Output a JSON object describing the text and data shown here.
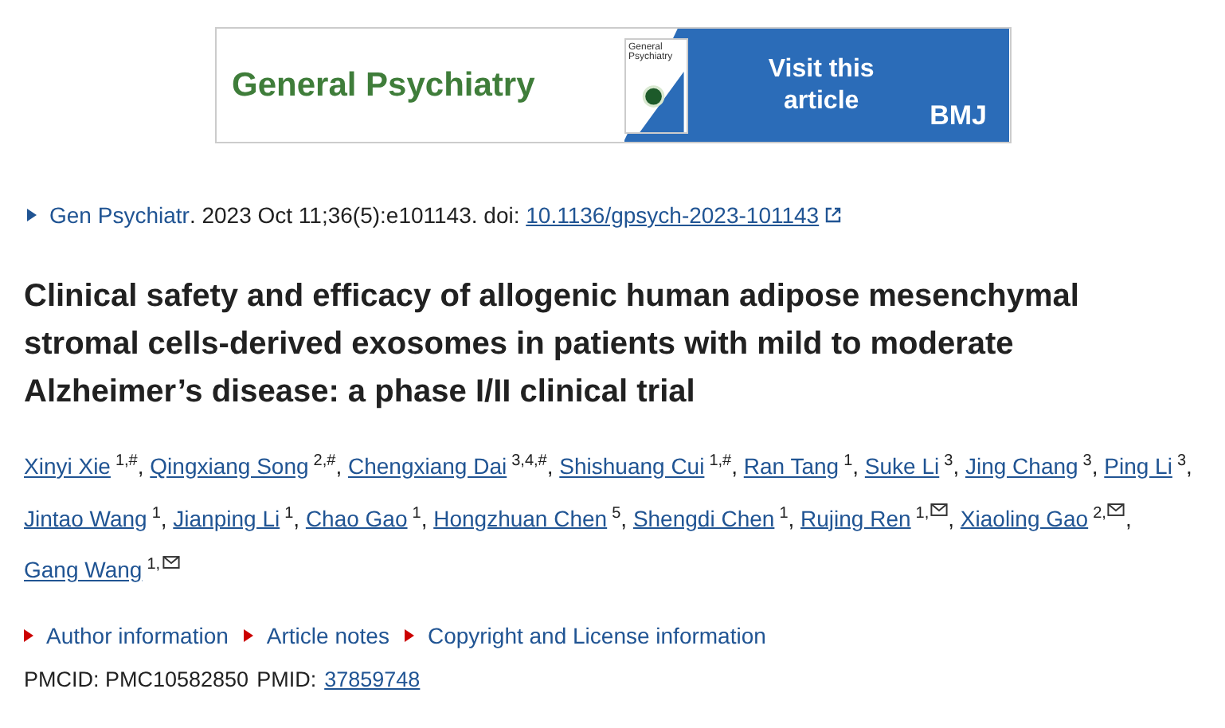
{
  "banner": {
    "journal": "General Psychiatry",
    "cover_title": "General Psychiatry",
    "cta": "Visit this article",
    "publisher": "BMJ"
  },
  "citation": {
    "journal": "Gen Psychiatr",
    "details": ". 2023 Oct 11;36(5):e101143. doi: ",
    "doi": "10.1136/gpsych-2023-101143"
  },
  "title": "Clinical safety and efficacy of allogenic human adipose mesenchymal stromal cells-derived exosomes in patients with mild to moderate Alzheimer’s disease: a phase I/II clinical trial",
  "authors": [
    {
      "name": "Xinyi Xie",
      "affiliations": "1,#",
      "corresponding": false,
      "separator": ","
    },
    {
      "name": "Qingxiang Song",
      "affiliations": "2,#",
      "corresponding": false,
      "separator": ","
    },
    {
      "name": "Chengxiang Dai",
      "affiliations": "3,4,#",
      "corresponding": false,
      "separator": ","
    },
    {
      "name": "Shishuang Cui",
      "affiliations": "1,#",
      "corresponding": false,
      "separator": ","
    },
    {
      "name": "Ran Tang",
      "affiliations": "1",
      "corresponding": false,
      "separator": ","
    },
    {
      "name": "Suke Li",
      "affiliations": "3",
      "corresponding": false,
      "separator": ","
    },
    {
      "name": "Jing Chang",
      "affiliations": "3",
      "corresponding": false,
      "separator": ","
    },
    {
      "name": "Ping Li",
      "affiliations": "3",
      "corresponding": false,
      "separator": ","
    },
    {
      "name": "Jintao Wang",
      "affiliations": "1",
      "corresponding": false,
      "separator": ","
    },
    {
      "name": "Jianping Li",
      "affiliations": "1",
      "corresponding": false,
      "separator": ","
    },
    {
      "name": "Chao Gao",
      "affiliations": "1",
      "corresponding": false,
      "separator": ","
    },
    {
      "name": "Hongzhuan Chen",
      "affiliations": "5",
      "corresponding": false,
      "separator": ","
    },
    {
      "name": "Shengdi Chen",
      "affiliations": "1",
      "corresponding": false,
      "separator": ","
    },
    {
      "name": "Rujing Ren",
      "affiliations": "1,",
      "corresponding": true,
      "separator": ","
    },
    {
      "name": "Xiaoling Gao",
      "affiliations": "2,",
      "corresponding": true,
      "separator": ","
    },
    {
      "name": "Gang Wang",
      "affiliations": "1,",
      "corresponding": true
    }
  ],
  "sections": [
    {
      "label": "Author information",
      "expanded": false
    },
    {
      "label": "Article notes",
      "expanded": false
    },
    {
      "label": "Copyright and License information",
      "expanded": false
    }
  ],
  "ids": {
    "pmcid_label": "PMCID:",
    "pmcid": "PMC10582850",
    "pmid_label": "PMID:",
    "pmid": "37859748"
  }
}
